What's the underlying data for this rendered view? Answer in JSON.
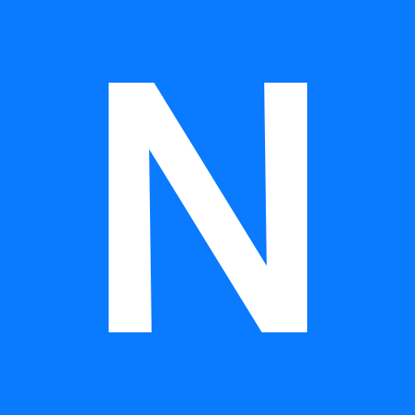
{
  "logo": {
    "letter": "N",
    "background_color": "#0A7BFF",
    "letter_color": "#FFFFFF"
  }
}
